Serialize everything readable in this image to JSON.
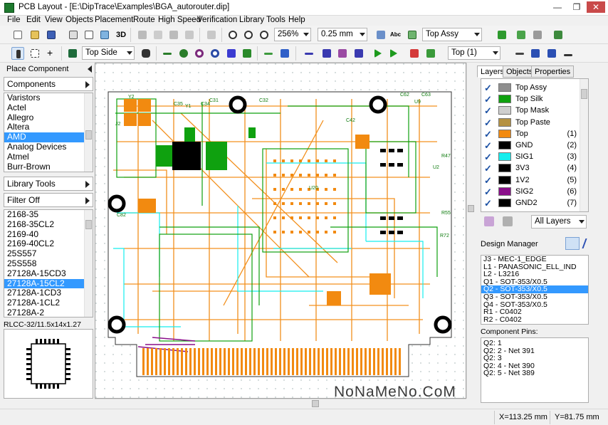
{
  "window": {
    "title": "PCB Layout - [E:\\DipTrace\\Examples\\BGA_autorouter.dip]",
    "minimize": "—",
    "restore": "❐",
    "close": "✕"
  },
  "menu": [
    "File",
    "Edit",
    "View",
    "Objects",
    "Placement",
    "Route",
    "High Speed",
    "Verification",
    "Library",
    "Tools",
    "Help"
  ],
  "toolbar1": {
    "view3d": "3D",
    "zoom_value": "256%",
    "grid_value": "0.25 mm",
    "assy_layer": "Top Assy"
  },
  "toolbar2": {
    "side_value": "Top Side",
    "layer_value": "Top (1)"
  },
  "left": {
    "place_component": "Place Component",
    "components_label": "Components",
    "manufacturers": [
      "Varistors",
      "Actel",
      "Allegro",
      "Altera",
      "AMD",
      "Analog Devices",
      "Atmel",
      "Burr-Brown"
    ],
    "manufacturer_selected": 4,
    "library_tools": "Library Tools",
    "filter_label": "Filter Off",
    "parts": [
      "2168-35",
      "2168-35CL2",
      "2169-40",
      "2169-40CL2",
      "25S557",
      "25S558",
      "27128A-15CD3",
      "27128A-15CL2",
      "27128A-1CD3",
      "27128A-1CL2",
      "27128A-2"
    ],
    "part_selected": 7,
    "pattern_name": "RLCC-32/11.5x14x1.27"
  },
  "right": {
    "tabs": [
      "Layers",
      "Objects",
      "Properties"
    ],
    "active_tab": "Layers",
    "layers": [
      {
        "name": "Top Assy",
        "num": "",
        "color": "#8f8f8f"
      },
      {
        "name": "Top Silk",
        "num": "",
        "color": "#0fa10f"
      },
      {
        "name": "Top Mask",
        "num": "",
        "color": "#cfcfcf"
      },
      {
        "name": "Top Paste",
        "num": "",
        "color": "#b59243"
      },
      {
        "name": "Top",
        "num": "(1)",
        "color": "#f28a10"
      },
      {
        "name": "GND",
        "num": "(2)",
        "color": "#000000"
      },
      {
        "name": "SIG1",
        "num": "(3)",
        "color": "#14eeee"
      },
      {
        "name": "3V3",
        "num": "(4)",
        "color": "#000000"
      },
      {
        "name": "1V2",
        "num": "(5)",
        "color": "#000000"
      },
      {
        "name": "SIG2",
        "num": "(6)",
        "color": "#8a0e8a"
      },
      {
        "name": "GND2",
        "num": "(7)",
        "color": "#000000"
      }
    ],
    "all_layers": "All Layers",
    "design_manager": "Design Manager",
    "dm_items": [
      "J3 - MEC-1_EDGE",
      "L1 - PANASONIC_ELL_IND",
      "L2 - L3216",
      "Q1 - SOT-353/X0.5",
      "Q2 - SOT-353/X0.5",
      "Q3 - SOT-353/X0.5",
      "Q4 - SOT-353/X0.5",
      "R1 - C0402",
      "R2 - C0402"
    ],
    "dm_selected": 4,
    "component_pins_label": "Component Pins:",
    "pins": [
      "Q2: 1",
      "Q2: 2 - Net 391",
      "Q2: 3",
      "Q2: 4 - Net 390",
      "Q2: 5 - Net 389"
    ]
  },
  "status": {
    "x": "X=113.25 mm",
    "y": "Y=81.75 mm"
  },
  "watermark": "NoNaMeNo.CoM",
  "board_labels": [
    "Y2",
    "C35",
    "C34",
    "J2",
    "C31",
    "C32",
    "Y1",
    "C42",
    "C62",
    "C63",
    "U9",
    "R47",
    "U2",
    "R72",
    "R55",
    "C82",
    "U20"
  ],
  "colors": {
    "selection": "#3399ff",
    "top_copper": "#f28a10",
    "silk": "#0fa10f",
    "sig1": "#14eeee",
    "sig2": "#8a0e8a"
  }
}
